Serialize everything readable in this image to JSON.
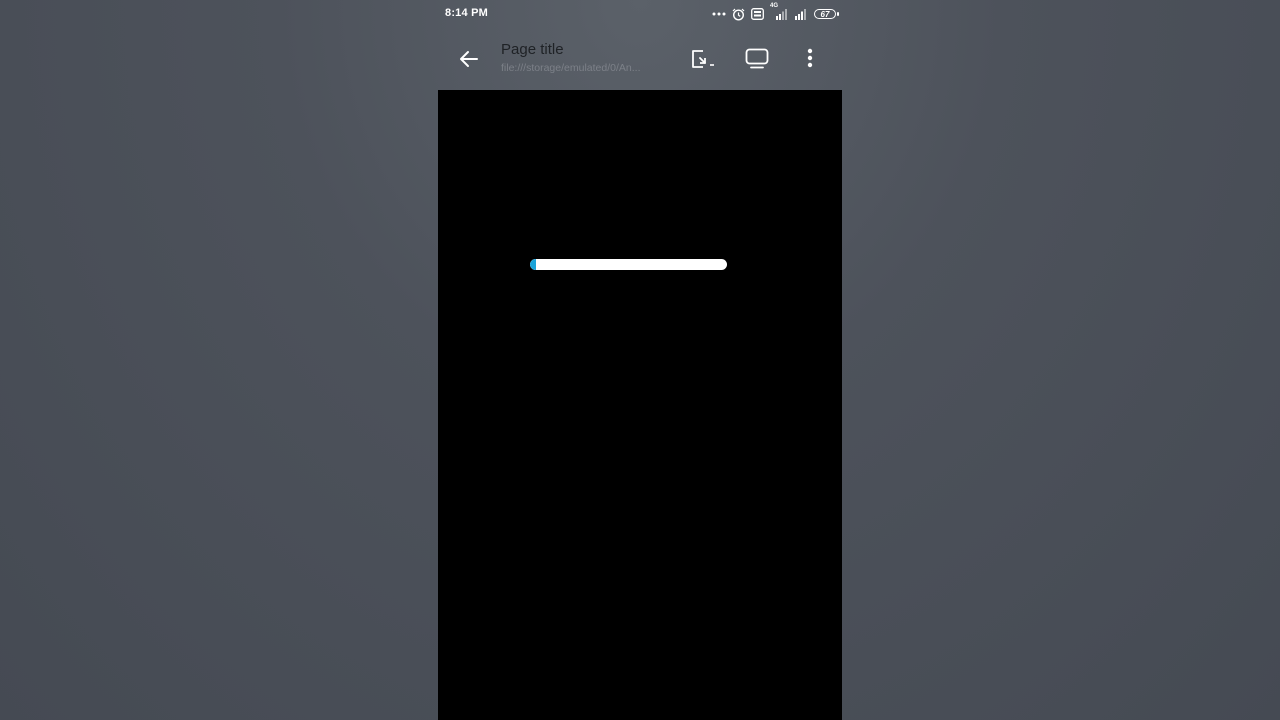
{
  "status_bar": {
    "time": "8:14 PM",
    "battery": "67",
    "network_label": "4G",
    "icons": [
      "more-dots-icon",
      "alarm-icon",
      "volte-icon",
      "signal-4g-icon",
      "signal-icon",
      "battery-icon"
    ]
  },
  "toolbar": {
    "back_icon": "arrow-left-icon",
    "title": "Page title",
    "url": "file:///storage/emulated/0/An...",
    "actions": [
      {
        "icon": "open-external-icon"
      },
      {
        "icon": "screen-mode-icon"
      },
      {
        "icon": "more-vertical-icon"
      }
    ]
  },
  "content": {
    "background": "#000000",
    "loading_progress": 0.03,
    "progress_fill_color": "#1aa3d9",
    "progress_track_color": "#ffffff"
  }
}
